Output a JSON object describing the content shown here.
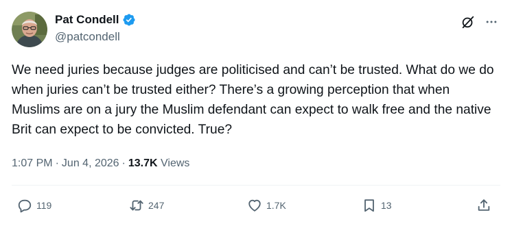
{
  "author": {
    "display_name": "Pat Condell",
    "handle": "@patcondell",
    "avatar_icon": "user-avatar-photo",
    "verified_icon": "verified-badge-icon"
  },
  "top_actions": {
    "grok_icon": "grok-icon",
    "more_icon": "more-horizontal-icon"
  },
  "tweet": {
    "text": "We need juries because judges are politicised and can’t be trusted. What do we do when juries can’t be trusted either? There’s a growing perception that when Muslims are on a jury the Muslim defendant can expect to walk free and the native Brit can expect to be convicted. True?"
  },
  "meta": {
    "time": "1:07 PM",
    "separator": "·",
    "date": "Jun 4, 2026",
    "views_count": "13.7K",
    "views_label": "Views"
  },
  "actions": {
    "reply": {
      "icon": "reply-icon",
      "count": "119"
    },
    "repost": {
      "icon": "repost-icon",
      "count": "247"
    },
    "like": {
      "icon": "heart-icon",
      "count": "1.7K"
    },
    "bookmark": {
      "icon": "bookmark-icon",
      "count": "13"
    },
    "share": {
      "icon": "share-icon"
    }
  },
  "colors": {
    "text_primary": "#0f1419",
    "text_secondary": "#536471",
    "verified_blue": "#1d9bf0",
    "divider": "#eff3f4"
  }
}
